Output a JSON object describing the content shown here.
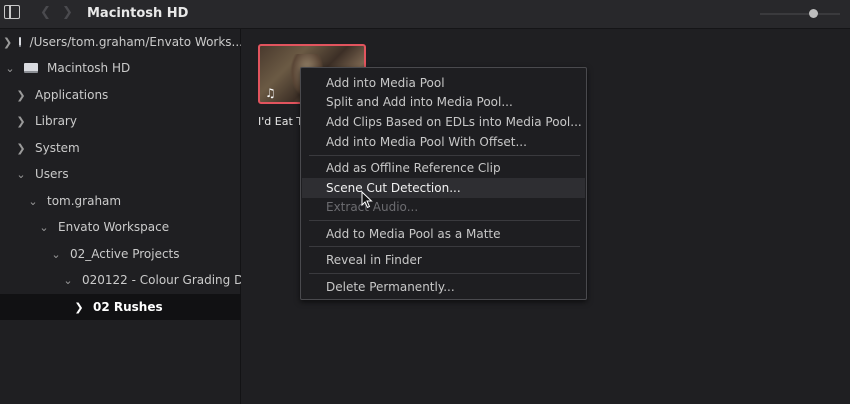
{
  "topbar": {
    "title": "Macintosh HD",
    "back_icon": "chevron-left-icon",
    "forward_icon": "chevron-right-icon",
    "sidebar_toggle_icon": "sidebar-toggle-icon"
  },
  "sidebar": {
    "items": [
      {
        "label": "/Users/tom.graham/Envato Works...",
        "expanded": false,
        "type": "drive"
      },
      {
        "label": "Macintosh HD",
        "expanded": true,
        "type": "drive"
      },
      {
        "label": "Applications",
        "expanded": false
      },
      {
        "label": "Library",
        "expanded": false
      },
      {
        "label": "System",
        "expanded": false
      },
      {
        "label": "Users",
        "expanded": true
      },
      {
        "label": "tom.graham",
        "expanded": true
      },
      {
        "label": "Envato Workspace",
        "expanded": true
      },
      {
        "label": "02_Active Projects",
        "expanded": true
      },
      {
        "label": "020122 - Colour Grading D...",
        "expanded": true
      },
      {
        "label": "02 Rushes",
        "expanded": false,
        "selected": true
      }
    ]
  },
  "content": {
    "clip": {
      "name": "I'd Eat Th",
      "icon": "music-note-icon",
      "selected_border_color": "#e2545e"
    }
  },
  "context_menu": {
    "items": [
      {
        "label": "Add into Media Pool",
        "state": "normal"
      },
      {
        "label": "Split and Add into Media Pool...",
        "state": "normal"
      },
      {
        "label": "Add Clips Based on EDLs into Media Pool...",
        "state": "normal"
      },
      {
        "label": "Add into Media Pool With Offset...",
        "state": "normal"
      },
      {
        "label": "Add as Offline Reference Clip",
        "state": "normal"
      },
      {
        "label": "Scene Cut Detection...",
        "state": "hover"
      },
      {
        "label": "Extract Audio...",
        "state": "disabled"
      },
      {
        "label": "Add to Media Pool as a Matte",
        "state": "normal"
      },
      {
        "label": "Reveal in Finder",
        "state": "normal"
      },
      {
        "label": "Delete Permanently...",
        "state": "normal"
      }
    ]
  }
}
